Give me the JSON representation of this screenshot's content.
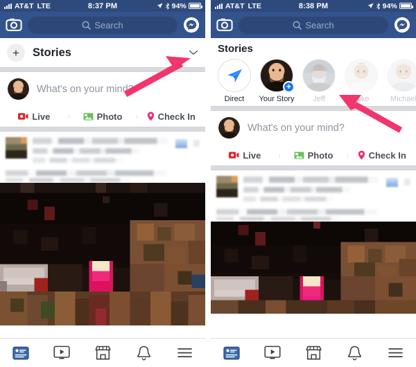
{
  "meta": {
    "accent_pink": "#f2356d",
    "fb_blue": "#33538d",
    "statusbar_blue": "#2e4a7d",
    "link_blue": "#1877f2"
  },
  "left_phone": {
    "statusbar": {
      "carrier": "AT&T",
      "network": "LTE",
      "time": "8:37 PM",
      "battery": "94%",
      "signal_icon": "signal-bars-icon",
      "location_icon": "location-arrow-icon",
      "bluetooth_icon": "bluetooth-icon",
      "battery_icon": "battery-icon"
    },
    "header": {
      "camera_icon": "camera-icon",
      "search_placeholder": "Search",
      "search_icon": "search-icon",
      "messenger_icon": "messenger-icon"
    },
    "stories": {
      "add_label": "+",
      "title": "Stories",
      "chevron_icon": "chevron-down-icon"
    },
    "composer": {
      "placeholder": "What's on your mind?",
      "avatar_icon": "user-avatar",
      "actions": [
        {
          "label": "Live",
          "icon": "live-video-icon",
          "color": "#e0242b"
        },
        {
          "label": "Photo",
          "icon": "photo-icon",
          "color": "#6bc05d"
        },
        {
          "label": "Check In",
          "icon": "location-pin-icon",
          "color": "#ec2f6b"
        }
      ]
    },
    "tabbar": [
      {
        "icon": "news-feed-icon",
        "active": true
      },
      {
        "icon": "watch-video-icon",
        "active": false
      },
      {
        "icon": "marketplace-icon",
        "active": false
      },
      {
        "icon": "notifications-bell-icon",
        "active": false
      },
      {
        "icon": "menu-hamburger-icon",
        "active": false
      }
    ]
  },
  "right_phone": {
    "statusbar": {
      "carrier": "AT&T",
      "network": "LTE",
      "time": "8:38 PM",
      "battery": "94%",
      "signal_icon": "signal-bars-icon",
      "location_icon": "location-arrow-icon",
      "bluetooth_icon": "bluetooth-icon",
      "battery_icon": "battery-icon"
    },
    "header": {
      "camera_icon": "camera-icon",
      "search_placeholder": "Search",
      "search_icon": "search-icon",
      "messenger_icon": "messenger-icon"
    },
    "stories": {
      "title": "Stories",
      "items": [
        {
          "label": "Direct",
          "icon": "paper-plane-icon",
          "type": "direct",
          "seen": false
        },
        {
          "label": "Your Story",
          "icon": "user-avatar",
          "type": "own",
          "badge": "+",
          "seen": false
        },
        {
          "label": "Jeff",
          "icon": "user-avatar",
          "type": "friend",
          "seen": true
        },
        {
          "label": "Mike",
          "icon": "user-avatar",
          "type": "friend",
          "seen": true
        },
        {
          "label": "Michael",
          "icon": "user-avatar",
          "type": "friend",
          "seen": true
        },
        {
          "label": "",
          "icon": "user-avatar",
          "type": "friend-partial",
          "seen": true
        }
      ]
    },
    "composer": {
      "placeholder": "What's on your mind?",
      "avatar_icon": "user-avatar",
      "actions": [
        {
          "label": "Live",
          "icon": "live-video-icon",
          "color": "#e0242b"
        },
        {
          "label": "Photo",
          "icon": "photo-icon",
          "color": "#6bc05d"
        },
        {
          "label": "Check In",
          "icon": "location-pin-icon",
          "color": "#ec2f6b"
        }
      ]
    },
    "tabbar": [
      {
        "icon": "news-feed-icon",
        "active": true
      },
      {
        "icon": "watch-video-icon",
        "active": false
      },
      {
        "icon": "marketplace-icon",
        "active": false
      },
      {
        "icon": "notifications-bell-icon",
        "active": false
      },
      {
        "icon": "menu-hamburger-icon",
        "active": false
      }
    ]
  },
  "annotations": [
    {
      "name": "arrow-to-chevron",
      "target": "chevron-down-icon",
      "color": "#f2356d"
    },
    {
      "name": "arrow-to-story-avatar",
      "target": "story-avatar-mike",
      "color": "#f2356d"
    }
  ]
}
